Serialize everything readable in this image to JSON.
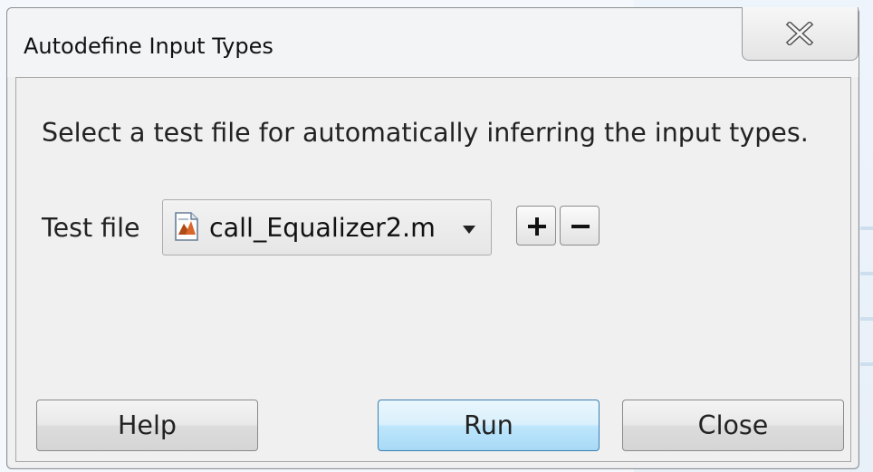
{
  "dialog": {
    "title": "Autodefine Input Types",
    "close_icon": "close-icon"
  },
  "content": {
    "instruction": "Select a test file for automatically inferring the input types.",
    "test_file_label": "Test file",
    "test_file_selected": "call_Equalizer2.m",
    "file_icon": "matlab-file-icon",
    "add_icon": "plus-icon",
    "remove_icon": "minus-icon"
  },
  "buttons": {
    "help": "Help",
    "run": "Run",
    "close": "Close"
  },
  "colors": {
    "primary_button_border": "#3c7fb1",
    "dialog_bg": "#f0f0f0"
  }
}
